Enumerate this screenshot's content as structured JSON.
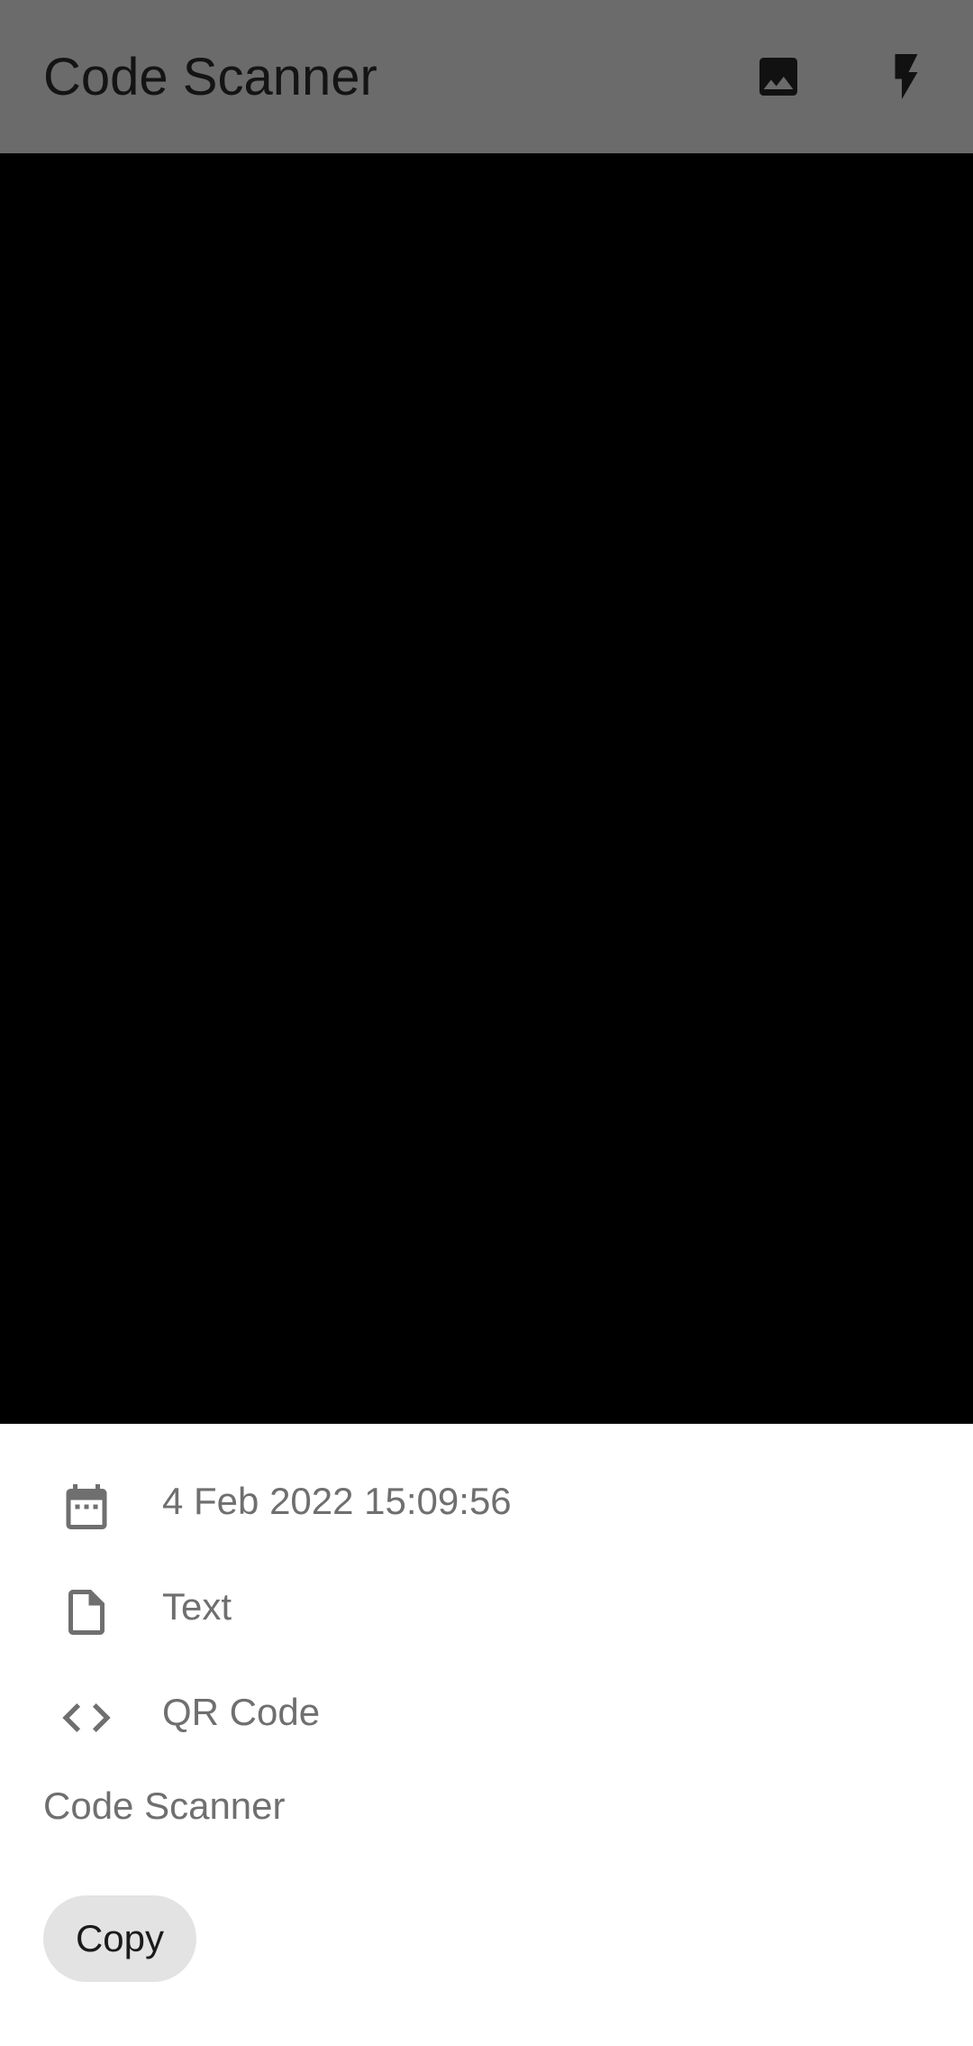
{
  "appbar": {
    "title": "Code Scanner",
    "actions": [
      {
        "icon": "image-icon"
      },
      {
        "icon": "flash-icon"
      }
    ]
  },
  "result": {
    "date": "4 Feb 2022 15:09:56",
    "content_type": "Text",
    "code_format": "QR Code",
    "content": "Code Scanner",
    "copy_label": "Copy"
  },
  "colors": {
    "appbar_background": "#6b6b6b",
    "camera_background": "#000000",
    "sheet_background": "#ffffff",
    "secondary_text": "#6f6f6f",
    "button_background": "#e3e3e3"
  }
}
